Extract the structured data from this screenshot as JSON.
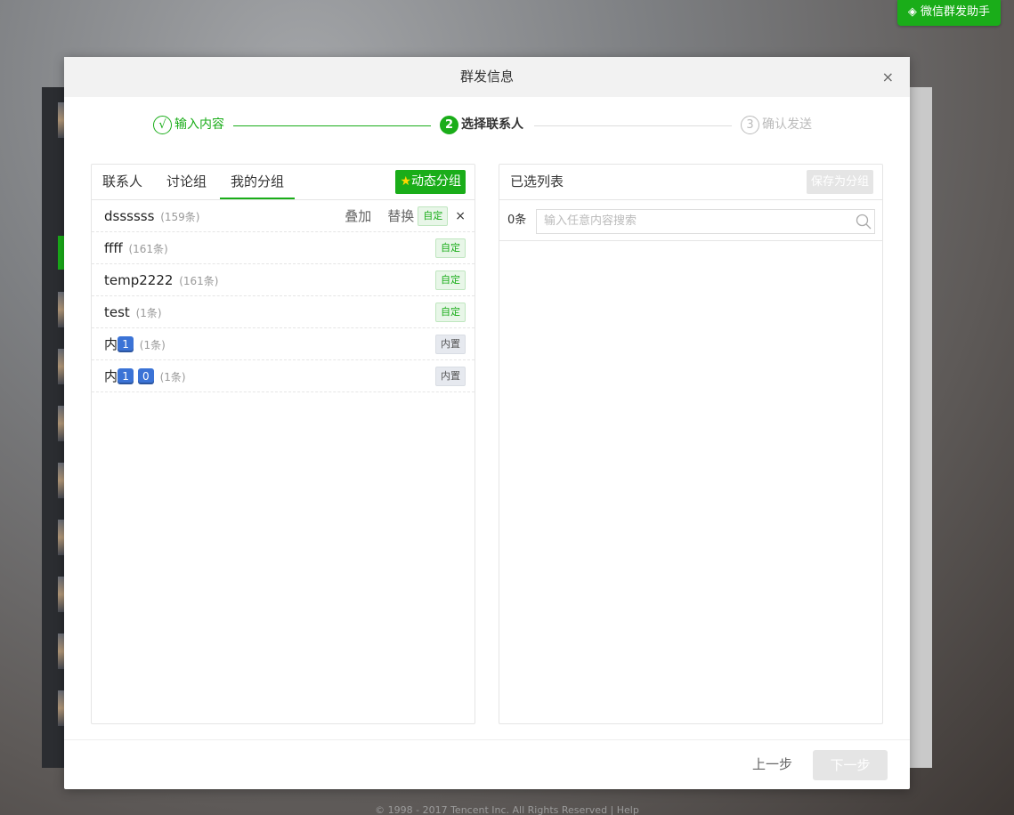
{
  "helper_button": "◈ 微信群发助手",
  "footer": "© 1998 - 2017 Tencent Inc. All Rights Reserved    |    Help",
  "dialog": {
    "title": "群发信息",
    "close": "×",
    "steps": [
      {
        "num": "√",
        "label": "输入内容"
      },
      {
        "num": "2",
        "label": "选择联系人"
      },
      {
        "num": "3",
        "label": "确认发送"
      }
    ]
  },
  "left_panel": {
    "tabs": [
      "联系人",
      "讨论组",
      "我的分组"
    ],
    "dynamic_button_star": "★",
    "dynamic_button": "动态分组",
    "groups": [
      {
        "name": "dssssss",
        "count": "(159条)",
        "badge": "自定",
        "action_add": "叠加",
        "action_replace": "替换",
        "remove": "×"
      },
      {
        "name": "ffff",
        "count": "(161条)",
        "badge": "自定"
      },
      {
        "name": "temp2222",
        "count": "(161条)",
        "badge": "自定"
      },
      {
        "name": "test",
        "count": "(1条)",
        "badge": "自定"
      },
      {
        "name": "内",
        "emoji": [
          "1"
        ],
        "count": "(1条)",
        "badge": "内置"
      },
      {
        "name": "内",
        "emoji": [
          "1",
          "0"
        ],
        "count": "(1条)",
        "badge": "内置"
      }
    ]
  },
  "right_panel": {
    "title": "已选列表",
    "save_button": "保存为分组",
    "count": "0条",
    "search_placeholder": "输入任意内容搜索"
  },
  "footer_buttons": {
    "prev": "上一步",
    "next": "下一步"
  },
  "colors": {
    "accent": "#1aad19",
    "disabled": "#e5e5e5"
  }
}
